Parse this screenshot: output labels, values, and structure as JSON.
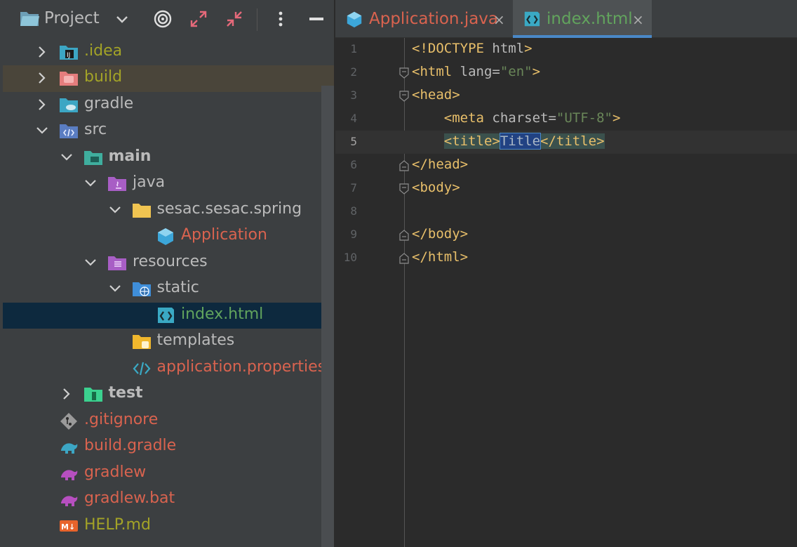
{
  "project_pane": {
    "title": "Project",
    "toolbar": [
      "select-opened-file",
      "expand-all",
      "collapse-all",
      "options",
      "hide"
    ]
  },
  "tree": [
    {
      "label": ".idea",
      "icon": "idea-folder-icon",
      "indent": 0,
      "arrow": "collapsed",
      "color": "olive"
    },
    {
      "label": "build",
      "icon": "excluded-folder-icon",
      "indent": 0,
      "arrow": "collapsed",
      "color": "olive",
      "highlight": true
    },
    {
      "label": "gradle",
      "icon": "gradle-folder-icon",
      "indent": 0,
      "arrow": "collapsed",
      "color": "default"
    },
    {
      "label": "src",
      "icon": "source-folder-icon",
      "indent": 0,
      "arrow": "expanded",
      "color": "default"
    },
    {
      "label": "main",
      "icon": "module-folder-icon",
      "indent": 1,
      "arrow": "expanded",
      "color": "default",
      "bold": true
    },
    {
      "label": "java",
      "icon": "java-source-folder-icon",
      "indent": 2,
      "arrow": "expanded",
      "color": "default"
    },
    {
      "label": "sesac.sesac.spring",
      "icon": "package-icon",
      "indent": 3,
      "arrow": "expanded",
      "color": "default"
    },
    {
      "label": "Application",
      "icon": "spring-class-icon",
      "indent": 4,
      "arrow": "none",
      "color": "red"
    },
    {
      "label": "resources",
      "icon": "resources-folder-icon",
      "indent": 2,
      "arrow": "expanded",
      "color": "default"
    },
    {
      "label": "static",
      "icon": "web-folder-icon",
      "indent": 3,
      "arrow": "expanded",
      "color": "default"
    },
    {
      "label": "index.html",
      "icon": "html-file-icon",
      "indent": 4,
      "arrow": "none",
      "color": "green",
      "selected": true
    },
    {
      "label": "templates",
      "icon": "templates-folder-icon",
      "indent": 3,
      "arrow": "none",
      "color": "default"
    },
    {
      "label": "application.properties",
      "icon": "properties-file-icon",
      "indent": 3,
      "arrow": "none",
      "color": "red"
    },
    {
      "label": "test",
      "icon": "test-folder-icon",
      "indent": 1,
      "arrow": "collapsed",
      "color": "default",
      "bold": true
    },
    {
      "label": ".gitignore",
      "icon": "gitignore-icon",
      "indent": 0,
      "arrow": "none",
      "color": "red"
    },
    {
      "label": "build.gradle",
      "icon": "gradle-file-icon",
      "indent": 0,
      "arrow": "none",
      "color": "red"
    },
    {
      "label": "gradlew",
      "icon": "gradlew-icon",
      "indent": 0,
      "arrow": "none",
      "color": "red"
    },
    {
      "label": "gradlew.bat",
      "icon": "gradlew-icon",
      "indent": 0,
      "arrow": "none",
      "color": "red"
    },
    {
      "label": "HELP.md",
      "icon": "markdown-icon",
      "indent": 0,
      "arrow": "none",
      "color": "olive"
    }
  ],
  "tabs": [
    {
      "label": "Application.java",
      "close": "×",
      "icon": "spring-class-icon",
      "color": "#d9634f",
      "active": false
    },
    {
      "label": "index.html",
      "close": "×",
      "icon": "html-file-icon",
      "color": "#62a45d",
      "active": true
    }
  ],
  "editor": {
    "current_line": 5,
    "lines": [
      {
        "n": "1",
        "fold": "",
        "indent": 0,
        "tokens": [
          [
            "tag",
            "<!DOCTYPE "
          ],
          [
            "attr",
            "html"
          ],
          [
            "tag",
            ">"
          ]
        ]
      },
      {
        "n": "2",
        "fold": "open",
        "indent": 0,
        "tokens": [
          [
            "tag",
            "<html "
          ],
          [
            "attr",
            "lang="
          ],
          [
            "str",
            "\"en\""
          ],
          [
            "tag",
            ">"
          ]
        ]
      },
      {
        "n": "3",
        "fold": "open",
        "indent": 0,
        "tokens": [
          [
            "tag",
            "<head>"
          ]
        ]
      },
      {
        "n": "4",
        "fold": "",
        "indent": 1,
        "tokens": [
          [
            "tag",
            "<meta "
          ],
          [
            "attr",
            "charset="
          ],
          [
            "str",
            "\"UTF-8\""
          ],
          [
            "tag",
            ">"
          ]
        ]
      },
      {
        "n": "5",
        "fold": "",
        "indent": 1,
        "tokens": [
          [
            "tag hl",
            "<title>"
          ],
          [
            "txt sel",
            "Title"
          ],
          [
            "tag hl",
            "</title>"
          ]
        ]
      },
      {
        "n": "6",
        "fold": "close",
        "indent": 0,
        "tokens": [
          [
            "tag",
            "</head>"
          ]
        ]
      },
      {
        "n": "7",
        "fold": "open",
        "indent": 0,
        "tokens": [
          [
            "tag",
            "<body>"
          ]
        ]
      },
      {
        "n": "8",
        "fold": "",
        "indent": 0,
        "tokens": []
      },
      {
        "n": "9",
        "fold": "close",
        "indent": 0,
        "tokens": [
          [
            "tag",
            "</body>"
          ]
        ]
      },
      {
        "n": "10",
        "fold": "close",
        "indent": 0,
        "tokens": [
          [
            "tag",
            "</html>"
          ]
        ]
      }
    ]
  },
  "colors": {
    "olive": "#a3a327",
    "red": "#d9634f",
    "green": "#62a45d",
    "tag": "#e8bf6a",
    "string": "#6a8759",
    "selection": "#214283",
    "tab_underline": "#4a88c7"
  }
}
